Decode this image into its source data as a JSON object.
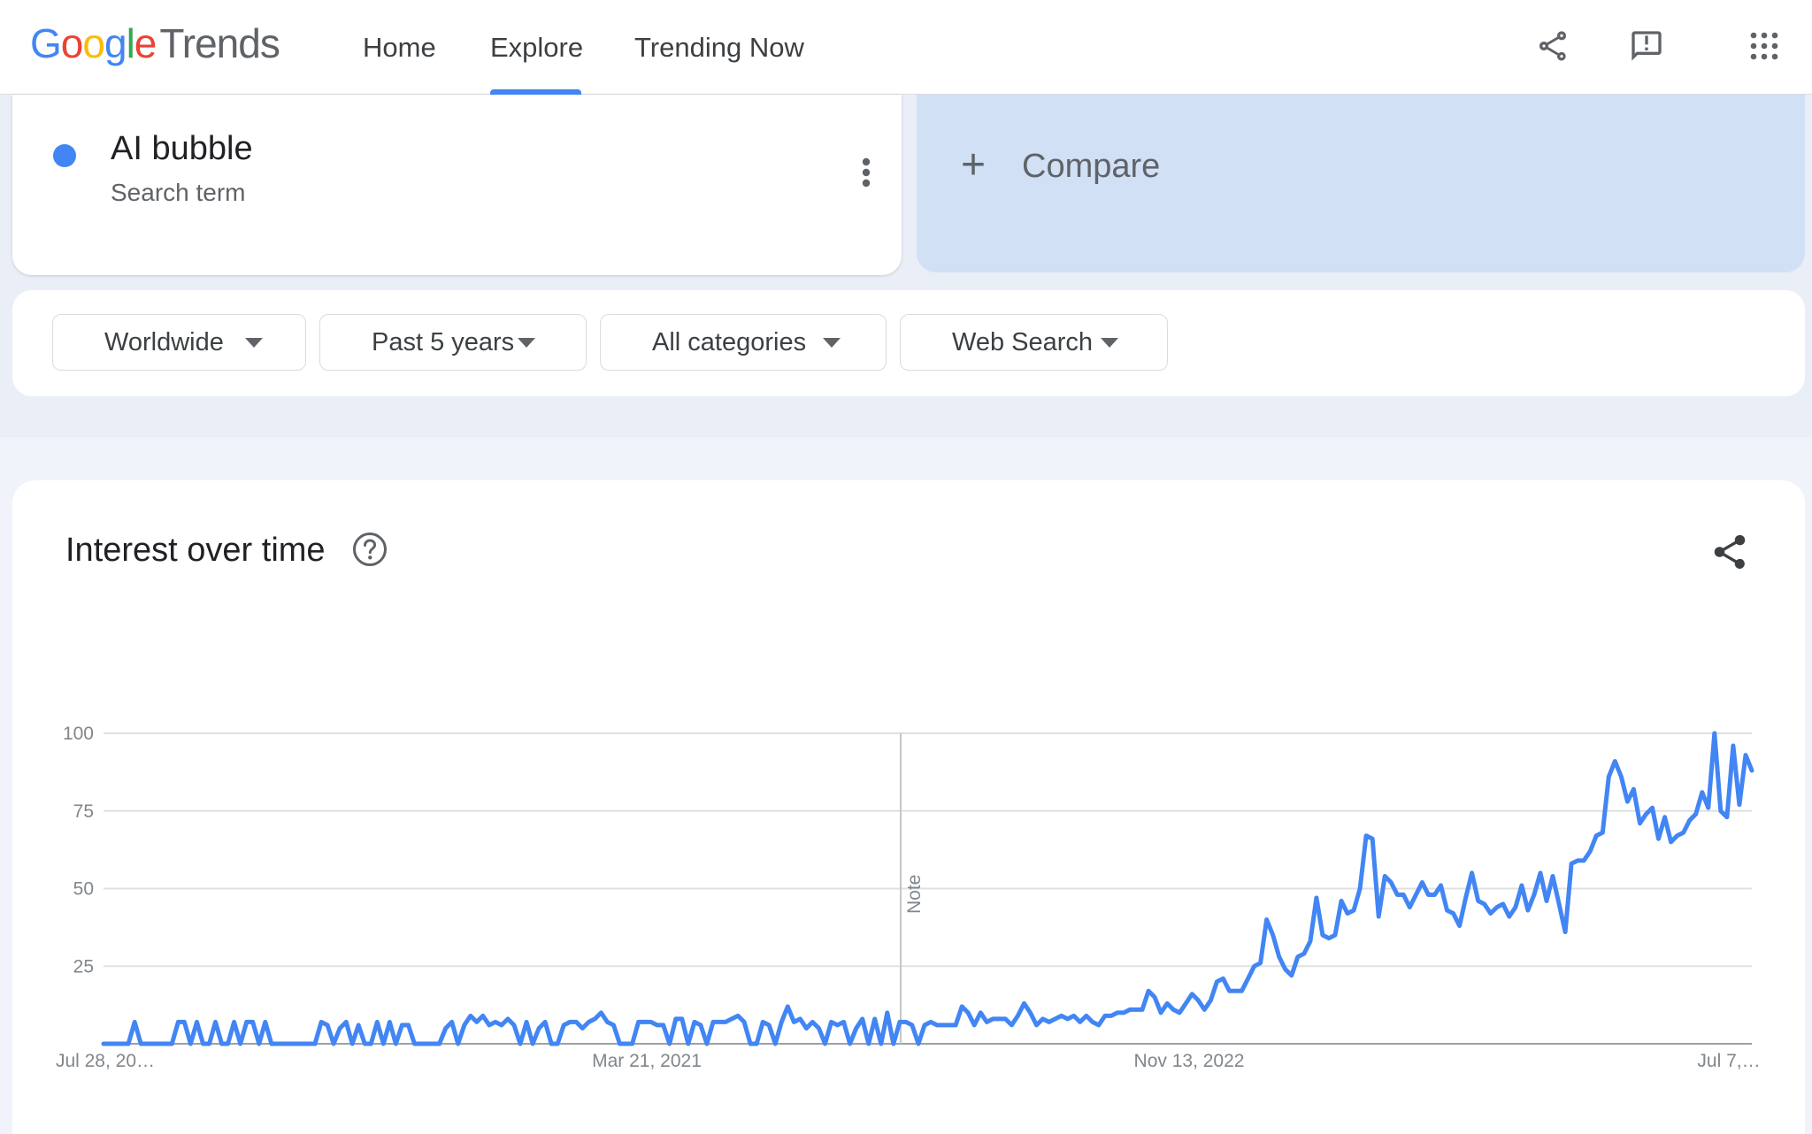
{
  "header": {
    "logo_google": "Google",
    "logo_trends": "Trends",
    "nav": [
      {
        "label": "Home"
      },
      {
        "label": "Explore",
        "active": true
      },
      {
        "label": "Trending Now"
      }
    ],
    "icons": [
      "share-icon",
      "feedback-icon",
      "apps-grid-icon"
    ]
  },
  "term": {
    "name": "AI bubble",
    "type": "Search term",
    "color": "#4285f4"
  },
  "compare": {
    "plus": "+",
    "label": "Compare"
  },
  "filters": [
    {
      "label": "Worldwide"
    },
    {
      "label": "Past 5 years"
    },
    {
      "label": "All categories"
    },
    {
      "label": "Web Search"
    }
  ],
  "chart": {
    "title": "Interest over time",
    "note_label": "Note"
  },
  "chart_data": {
    "type": "line",
    "title": "Interest over time",
    "xlabel": "",
    "ylabel": "",
    "ylim": [
      0,
      100
    ],
    "yticks": [
      25,
      50,
      75,
      100
    ],
    "xtick_labels": [
      "Jul 28, 20…",
      "Mar 21, 2021",
      "Nov 13, 2022",
      "Jul 7,…"
    ],
    "grid": true,
    "series_color": "#4285f4",
    "series": [
      {
        "name": "AI bubble",
        "values": [
          0,
          0,
          0,
          0,
          0,
          7,
          0,
          0,
          0,
          0,
          0,
          0,
          7,
          7,
          0,
          7,
          0,
          0,
          7,
          0,
          0,
          7,
          0,
          7,
          7,
          0,
          7,
          0,
          0,
          0,
          0,
          0,
          0,
          0,
          0,
          7,
          6,
          0,
          5,
          7,
          0,
          6,
          0,
          0,
          7,
          0,
          7,
          0,
          6,
          6,
          0,
          0,
          0,
          0,
          0,
          5,
          7,
          0,
          6,
          9,
          7,
          9,
          6,
          7,
          6,
          8,
          6,
          0,
          7,
          0,
          5,
          7,
          0,
          0,
          6,
          7,
          7,
          5,
          7,
          8,
          10,
          7,
          6,
          0,
          0,
          0,
          7,
          7,
          7,
          6,
          6,
          0,
          8,
          8,
          0,
          7,
          6,
          0,
          7,
          7,
          7,
          8,
          9,
          7,
          0,
          0,
          7,
          6,
          0,
          7,
          12,
          7,
          8,
          5,
          7,
          5,
          0,
          7,
          6,
          7,
          0,
          5,
          8,
          0,
          8,
          0,
          10,
          0,
          7,
          7,
          6,
          0,
          6,
          7,
          6,
          6,
          6,
          6,
          12,
          10,
          6,
          10,
          7,
          8,
          8,
          8,
          6,
          9,
          13,
          10,
          6,
          8,
          7,
          8,
          9,
          8,
          9,
          7,
          9,
          7,
          6,
          9,
          9,
          10,
          10,
          11,
          11,
          11,
          17,
          15,
          10,
          13,
          11,
          10,
          13,
          16,
          14,
          11,
          14,
          20,
          21,
          17,
          17,
          17,
          21,
          25,
          26,
          40,
          35,
          28,
          24,
          22,
          28,
          29,
          33,
          47,
          35,
          34,
          35,
          46,
          42,
          43,
          50,
          67,
          66,
          41,
          54,
          52,
          48,
          48,
          44,
          48,
          52,
          48,
          48,
          51,
          43,
          42,
          38,
          47,
          55,
          46,
          45,
          42,
          44,
          45,
          41,
          44,
          51,
          43,
          48,
          55,
          46,
          54,
          45,
          36,
          58,
          59,
          59,
          62,
          67,
          68,
          86,
          91,
          86,
          78,
          82,
          71,
          74,
          76,
          66,
          73,
          65,
          67,
          68,
          72,
          74,
          81,
          76,
          100,
          75,
          73,
          96,
          77,
          93,
          88
        ]
      }
    ]
  }
}
